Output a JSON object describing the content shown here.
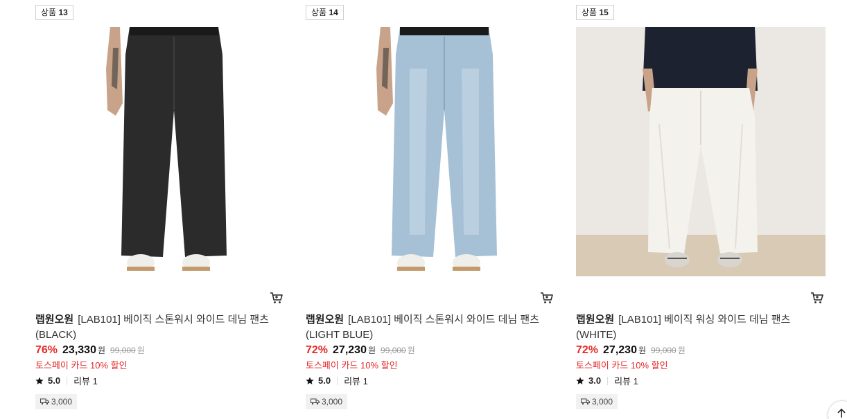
{
  "products": [
    {
      "badge_prefix": "상품",
      "badge_num": "13",
      "brand": "랩원오원",
      "name": "[LAB101] 베이직 스톤워시 와이드 데님 팬츠 (BLACK)",
      "discount": "76%",
      "price": "23,330",
      "won": "원",
      "orig_price": "99,000",
      "promo": "토스페이 카드 10% 할인",
      "rating": "5.0",
      "review": "리뷰 1",
      "shipping": "3,000",
      "denim_color": "#2b2b2b",
      "bg_color": "#ffffff"
    },
    {
      "badge_prefix": "상품",
      "badge_num": "14",
      "brand": "랩원오원",
      "name": "[LAB101] 베이직 스톤워시 와이드 데님 팬츠 (LIGHT BLUE)",
      "discount": "72%",
      "price": "27,230",
      "won": "원",
      "orig_price": "99,000",
      "promo": "토스페이 카드 10% 할인",
      "rating": "5.0",
      "review": "리뷰 1",
      "shipping": "3,000",
      "denim_color": "#a6c0d6",
      "bg_color": "#ffffff"
    },
    {
      "badge_prefix": "상품",
      "badge_num": "15",
      "brand": "랩원오원",
      "name": "[LAB101] 베이직 워싱 와이드 데님 팬츠 (WHITE)",
      "discount": "72%",
      "price": "27,230",
      "won": "원",
      "orig_price": "99,000",
      "promo": "토스페이 카드 10% 할인",
      "rating": "3.0",
      "review": "리뷰 1",
      "shipping": "3,000",
      "denim_color": "#f4f2ec",
      "bg_color": "#e9e6e0"
    }
  ],
  "icons": {
    "cart": "cart-icon",
    "star": "star-icon",
    "truck": "truck-icon",
    "top": "arrow-up-icon"
  },
  "colors": {
    "discount": "#e52929",
    "promo": "#e52929"
  }
}
